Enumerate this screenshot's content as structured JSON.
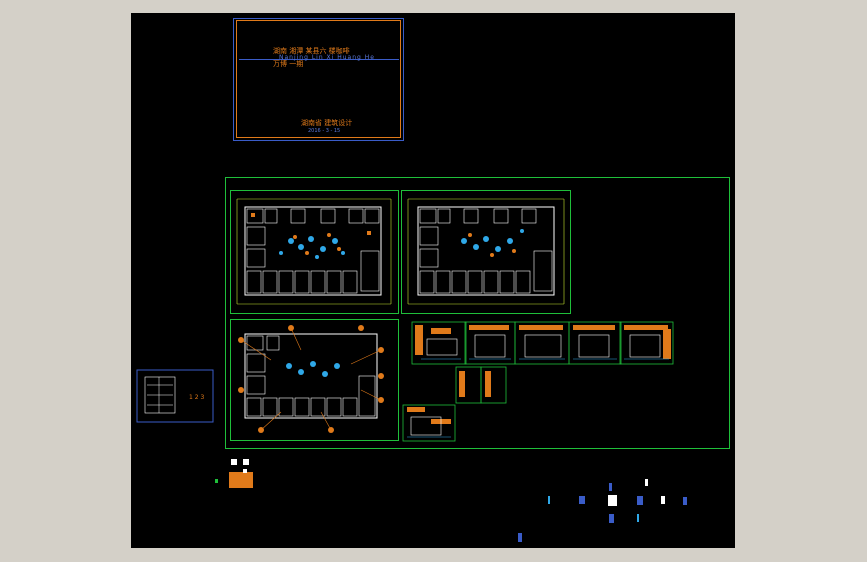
{
  "titleblock": {
    "line1": "湖南 湘潭 某县六 楼咖啡",
    "line2": "Nanjing Lin Xi Huang He",
    "line3": "万博 一期",
    "company": "湖南省 建筑设计",
    "date": "2016 - 3 - 15"
  },
  "legend": {
    "label": "1 2 3"
  },
  "colors": {
    "background": "#000000",
    "frame": "#1fbf3a",
    "wall": "#ffffff",
    "dimension": "#c8e830",
    "annotation": "#e07a1a",
    "furniture": "#2fa8e8",
    "border_blue": "#3a5cc8"
  }
}
